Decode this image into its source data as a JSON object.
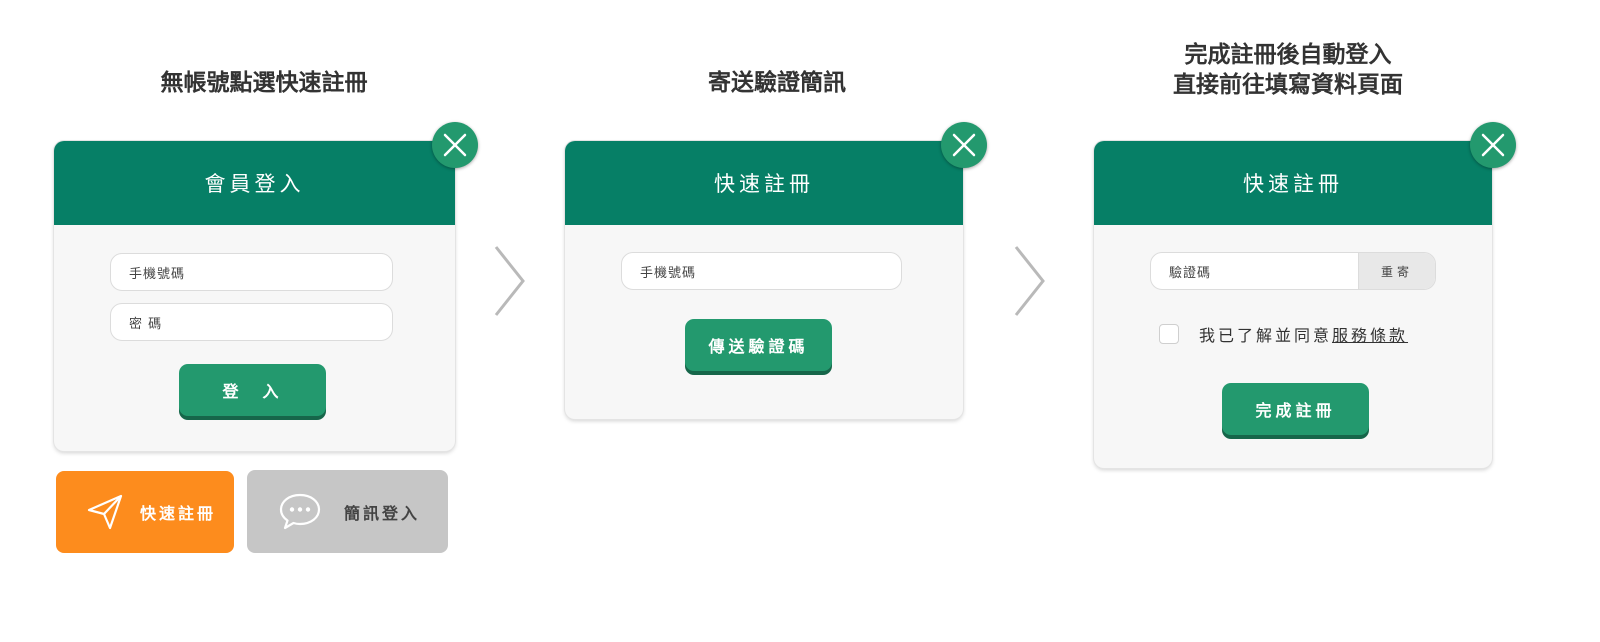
{
  "steps": [
    {
      "title_lines": [
        "無帳號點選快速註冊"
      ],
      "panel_title": "會員登入",
      "phone_placeholder": "手機號碼",
      "password_placeholder": "密 碼",
      "login_label": "登　入",
      "quick_register_label": "快速註冊",
      "sms_login_label": "簡訊登入"
    },
    {
      "title_lines": [
        "寄送驗證簡訊"
      ],
      "panel_title": "快速註冊",
      "phone_placeholder": "手機號碼",
      "send_code_label": "傳送驗證碼"
    },
    {
      "title_lines": [
        "完成註冊後自動登入",
        "直接前往填寫資料頁面"
      ],
      "panel_title": "快速註冊",
      "code_placeholder": "驗證碼",
      "resend_label": "重寄",
      "agree_text": "我已了解並同意",
      "terms_link": "服務條款",
      "complete_label": "完成註冊"
    }
  ],
  "icons": {
    "close": "close-icon",
    "arrow": "chevron-right-icon",
    "send": "paper-plane-icon",
    "sms": "chat-bubble-icon"
  },
  "colors": {
    "header_green": "#067f66",
    "button_green": "#23996e",
    "orange": "#fd8c1d",
    "gray": "#c6c6c6"
  }
}
